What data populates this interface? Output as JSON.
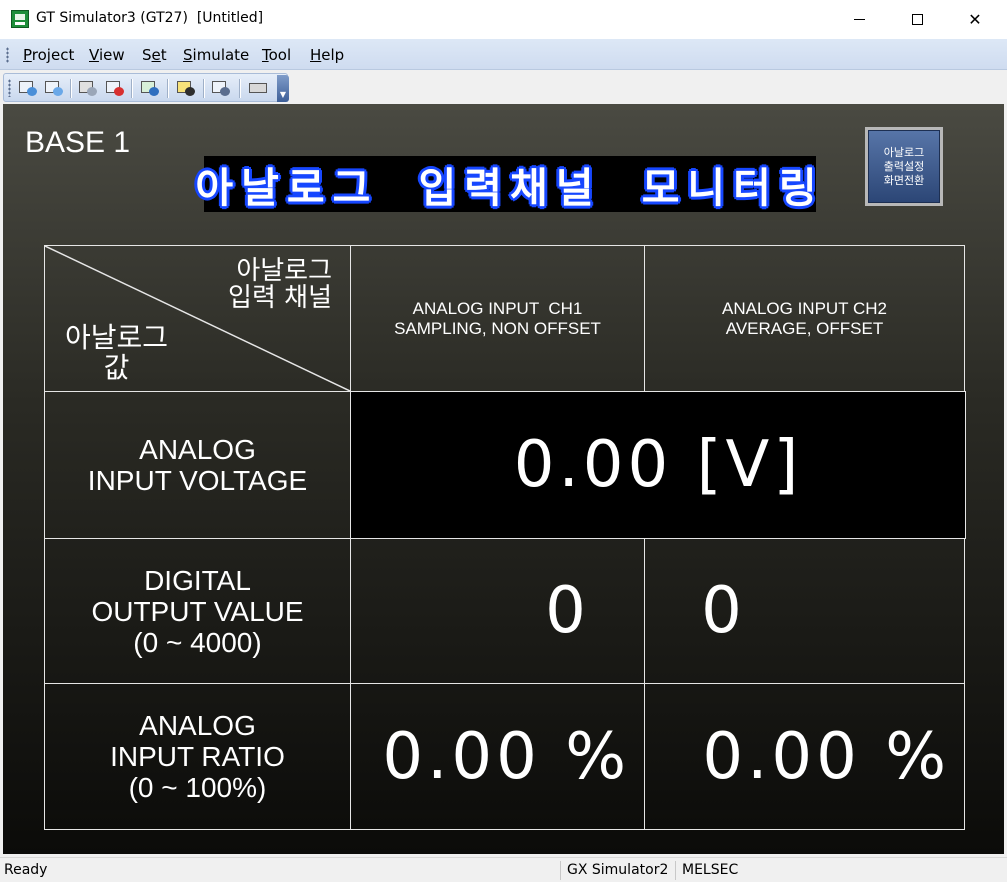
{
  "window": {
    "title": "GT Simulator3 (GT27)  [Untitled]",
    "minimize_glyph": "",
    "maximize_glyph": "",
    "close_glyph": "✕"
  },
  "menu": {
    "items": [
      {
        "first": "P",
        "rest": "roject"
      },
      {
        "first": "V",
        "rest": "iew"
      },
      {
        "first": "S",
        "rest": "et",
        "underline_index": 1,
        "label_pre": "S",
        "label_ul": "e",
        "label_post": "t"
      },
      {
        "first": "S",
        "rest": "imulate"
      },
      {
        "first": "T",
        "rest": "ool"
      },
      {
        "first": "H",
        "rest": "elp"
      }
    ]
  },
  "toolbar": {
    "icons": [
      "open-project-icon",
      "save-project-icon",
      "disconnect-icon",
      "record-icon",
      "device-monitor-icon",
      "script-icon",
      "connect-settings-icon",
      "keyboard-icon"
    ]
  },
  "screen": {
    "base_label": "BASE 1",
    "banner_title": "아날로그 입력채널 모니터링",
    "nav_button_label": "아날로그\n출력설정\n화면전환",
    "table": {
      "corner_top": "아날로그\n입력 채널",
      "corner_bottom": "아날로그\n값",
      "ch1_header": "ANALOG INPUT  CH1\nSAMPLING, NON OFFSET",
      "ch2_header": "ANALOG INPUT CH2\nAVERAGE, OFFSET",
      "row1_label": "ANALOG\nINPUT VOLTAGE",
      "row1_value": "0.00 [V]",
      "row2_label": "DIGITAL\nOUTPUT VALUE\n(0 ~ 4000)",
      "row2_ch1": "0",
      "row2_ch2": "0",
      "row3_label": "ANALOG\nINPUT RATIO\n(0 ~ 100%)",
      "row3_ch1": "0.00 %",
      "row3_ch2": "0.00 %"
    }
  },
  "status": {
    "ready": "Ready",
    "simulator": "GX Simulator2",
    "plc": "MELSEC"
  },
  "colors": {
    "banner_glow": "#1848ff",
    "nav_button": "#3f5c90",
    "menubar": "#d6e2f3"
  }
}
